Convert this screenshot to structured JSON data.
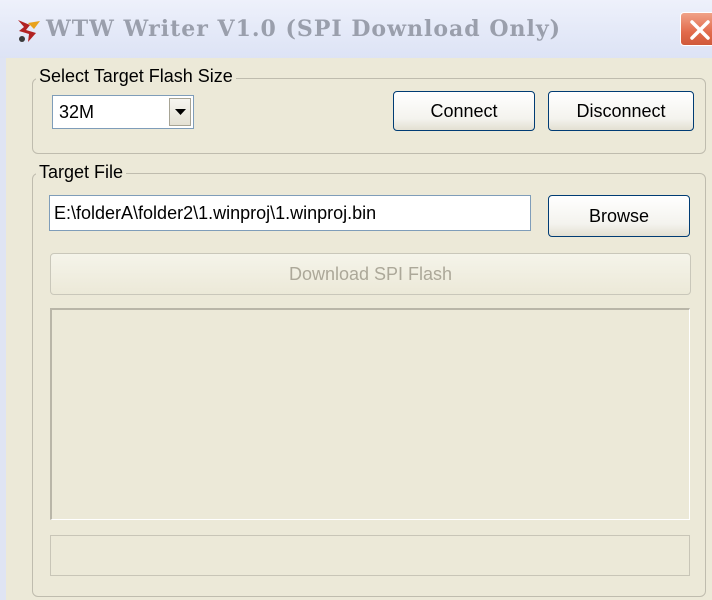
{
  "window": {
    "title": "WTW Writer V1.0 (SPI Download Only)",
    "app_icon": "app-logo-icon",
    "close_icon": "close-icon",
    "colors": {
      "close_button": "#e26b4c",
      "title_text": "#9a9fac",
      "client_bg": "#ece9d8"
    }
  },
  "flash_group": {
    "title": "Select Target Flash Size",
    "size_select": {
      "selected": "32M",
      "arrow_icon": "chevron-down-icon"
    },
    "connect_label": "Connect",
    "disconnect_label": "Disconnect"
  },
  "file_group": {
    "title": "Target File",
    "file_path": "E:\\folderA\\folder2\\1.winproj\\1.winproj.bin",
    "browse_label": "Browse",
    "download_label": "Download SPI Flash",
    "download_enabled": false
  }
}
